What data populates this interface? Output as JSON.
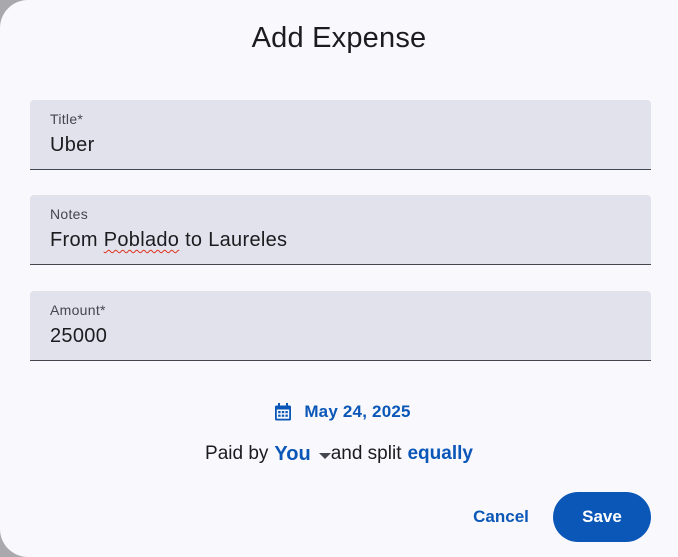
{
  "dialog": {
    "title": "Add Expense"
  },
  "fields": {
    "title": {
      "label": "Title*",
      "value": "Uber"
    },
    "notes": {
      "label": "Notes",
      "value_prefix": "From ",
      "value_flagged": "Poblado",
      "value_suffix": " to Laureles"
    },
    "amount": {
      "label": "Amount*",
      "value": "25000"
    }
  },
  "date": {
    "icon": "calendar-icon",
    "value": "May 24, 2025"
  },
  "split": {
    "paid_by_label": "Paid by",
    "payer": "You",
    "payer_icon": "dropdown-arrow-icon",
    "and_split_label": "and split",
    "split_mode": "equally"
  },
  "actions": {
    "cancel_label": "Cancel",
    "save_label": "Save"
  },
  "colors": {
    "accent": "#0b57b8",
    "field_background": "#e1e2eb",
    "dialog_background": "#f9f8fc"
  }
}
